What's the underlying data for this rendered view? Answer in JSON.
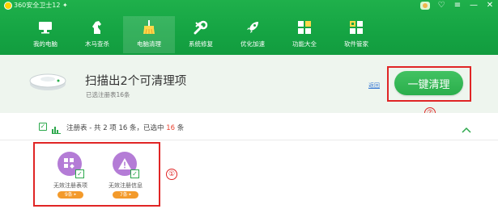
{
  "window": {
    "title": "360安全卫士12 ✦",
    "controls": [
      "♡",
      "≡",
      "—",
      "✕"
    ]
  },
  "nav": {
    "items": [
      {
        "label": "我的电脑",
        "icon": "monitor-icon",
        "active": false
      },
      {
        "label": "木马查杀",
        "icon": "horse-icon",
        "active": false
      },
      {
        "label": "电脑清理",
        "icon": "broom-icon",
        "active": true
      },
      {
        "label": "系统修复",
        "icon": "wrench-icon",
        "active": false
      },
      {
        "label": "优化加速",
        "icon": "rocket-icon",
        "active": false
      },
      {
        "label": "功能大全",
        "icon": "apps-grid-icon",
        "active": false
      },
      {
        "label": "软件管家",
        "icon": "software-store-icon",
        "active": false
      }
    ]
  },
  "summary": {
    "title": "扫描出2个可清理项",
    "subtitle": "已选注册表16条",
    "return_link": "返回",
    "clean_button": "一键清理"
  },
  "category": {
    "name": "注册表",
    "prefix": " - 共 2 项 16 条，已选中 ",
    "selected_count": "16",
    "suffix": " 条",
    "collapse_icon": "chevron-up-icon"
  },
  "items": [
    {
      "label": "无效注册表项",
      "badge": "9条",
      "icon": "registry-blocks-icon"
    },
    {
      "label": "无效注册信息",
      "badge": "7条",
      "icon": "warning-triangle-icon"
    }
  ],
  "annotations": {
    "marker_1": "①",
    "marker_2": "②"
  },
  "colors": {
    "brand_green": "#15a443",
    "button_green": "#2aae4b",
    "highlight_red": "#e8412f",
    "annotation_red": "#e02525",
    "item_purple": "#b47cd6",
    "badge_orange": "#f39a2b"
  }
}
